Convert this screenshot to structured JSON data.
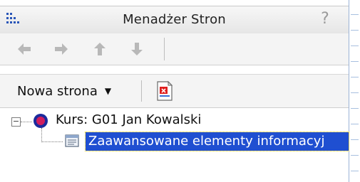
{
  "window": {
    "title": "Menadżer Stron",
    "help_icon": "?"
  },
  "navigation": {
    "buttons": [
      {
        "name": "arrow-left-icon"
      },
      {
        "name": "arrow-right-icon"
      },
      {
        "name": "arrow-up-icon"
      },
      {
        "name": "arrow-down-icon"
      }
    ]
  },
  "toolbar": {
    "new_page_label": "Nowa strona",
    "new_page_caret": "▼",
    "page_icon": "new-page-icon"
  },
  "tree": {
    "root": {
      "label": "Kurs: G01 Jan Kowalski",
      "expander": "−",
      "icon": "course-icon"
    },
    "children": [
      {
        "label": "Zaawansowane elementy informacyj",
        "icon": "document-icon",
        "selected": true
      }
    ]
  },
  "colors": {
    "selection": "#1f4fd1",
    "arrow": "#b8b8b8"
  }
}
